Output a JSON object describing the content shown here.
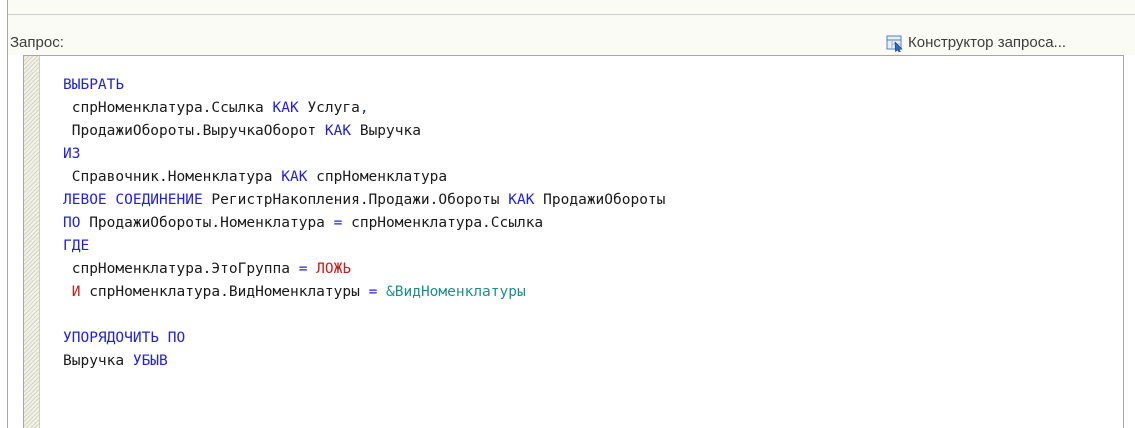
{
  "header": {
    "query_label": "Запрос:",
    "constructor_label": "Конструктор запроса..."
  },
  "colors": {
    "keyword": "#2222dd",
    "operator": "#d11a1a",
    "parameter": "#1e8f8f",
    "text": "#1a1a1a"
  },
  "editor": {
    "lines": [
      [
        {
          "t": "ВЫБРАТЬ",
          "c": "kw"
        }
      ],
      [
        {
          "t": " спрНоменклатура.Ссылка ",
          "c": ""
        },
        {
          "t": "КАК",
          "c": "kw"
        },
        {
          "t": " Услуга",
          "c": ""
        },
        {
          "t": ",",
          "c": "kw"
        }
      ],
      [
        {
          "t": " ПродажиОбороты.ВыручкаОборот ",
          "c": ""
        },
        {
          "t": "КАК",
          "c": "kw"
        },
        {
          "t": " Выручка",
          "c": ""
        }
      ],
      [
        {
          "t": "ИЗ",
          "c": "kw"
        }
      ],
      [
        {
          "t": " Справочник.Номенклатура ",
          "c": ""
        },
        {
          "t": "КАК",
          "c": "kw"
        },
        {
          "t": " спрНоменклатура",
          "c": ""
        }
      ],
      [
        {
          "t": "ЛЕВОЕ СОЕДИНЕНИЕ",
          "c": "kw"
        },
        {
          "t": " РегистрНакопления.Продажи.Обороты ",
          "c": ""
        },
        {
          "t": "КАК",
          "c": "kw"
        },
        {
          "t": " ПродажиОбороты",
          "c": ""
        }
      ],
      [
        {
          "t": "ПО",
          "c": "kw"
        },
        {
          "t": " ПродажиОбороты.Номенклатура ",
          "c": ""
        },
        {
          "t": "=",
          "c": "kw"
        },
        {
          "t": " спрНоменклатура.Ссылка",
          "c": ""
        }
      ],
      [
        {
          "t": "ГДЕ",
          "c": "kw"
        }
      ],
      [
        {
          "t": " спрНоменклатура.ЭтоГруппа ",
          "c": ""
        },
        {
          "t": "=",
          "c": "kw"
        },
        {
          "t": " ",
          "c": ""
        },
        {
          "t": "ЛОЖЬ",
          "c": "op"
        }
      ],
      [
        {
          "t": " ",
          "c": ""
        },
        {
          "t": "И",
          "c": "op"
        },
        {
          "t": " спрНоменклатура.ВидНоменклатуры ",
          "c": ""
        },
        {
          "t": "=",
          "c": "kw"
        },
        {
          "t": " ",
          "c": ""
        },
        {
          "t": "&ВидНоменклатуры",
          "c": "prm"
        }
      ],
      [],
      [
        {
          "t": "УПОРЯДОЧИТЬ ПО",
          "c": "kw"
        }
      ],
      [
        {
          "t": "Выручка ",
          "c": ""
        },
        {
          "t": "УБЫВ",
          "c": "kw"
        }
      ]
    ]
  }
}
